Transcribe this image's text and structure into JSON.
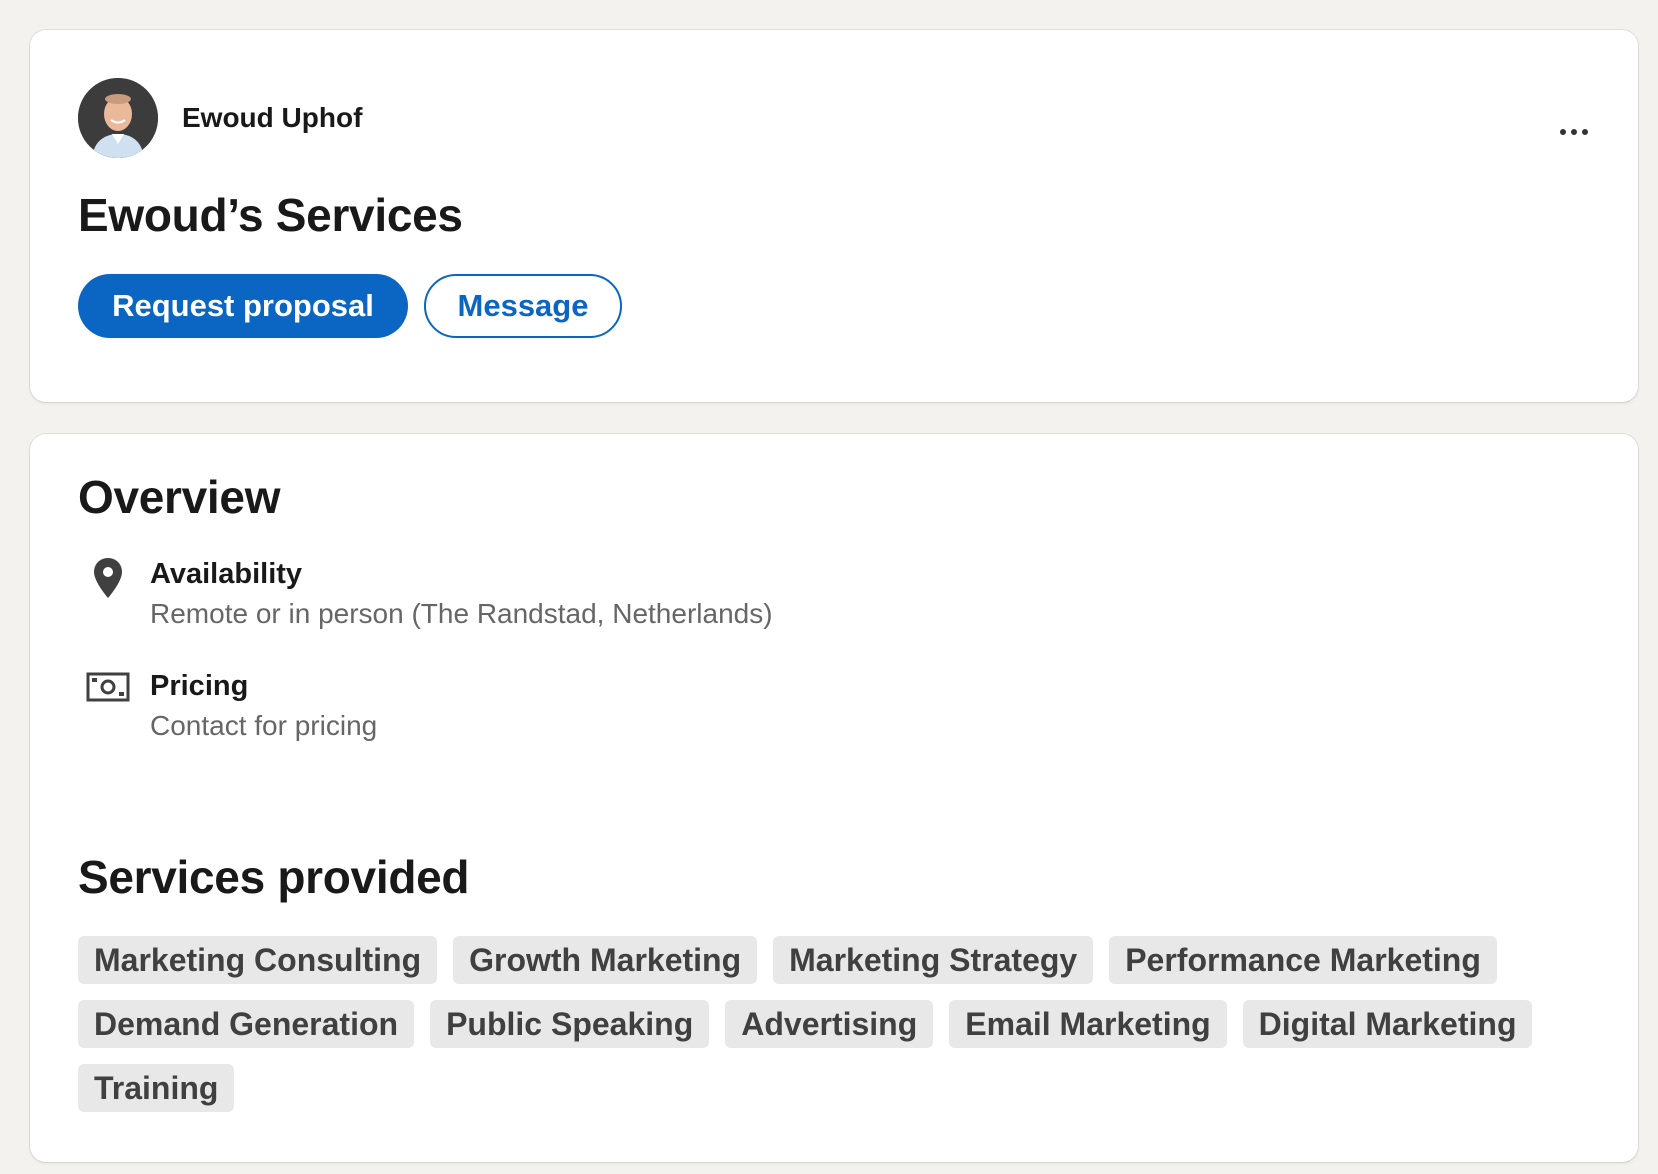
{
  "profile": {
    "name": "Ewoud Uphof",
    "services_title": "Ewoud’s Services"
  },
  "actions": {
    "request_proposal": "Request proposal",
    "message": "Message",
    "more_icon": "ellipsis-icon"
  },
  "overview": {
    "title": "Overview",
    "availability": {
      "icon": "location-pin-icon",
      "label": "Availability",
      "value": "Remote or in person (The Randstad, Netherlands)"
    },
    "pricing": {
      "icon": "money-bill-icon",
      "label": "Pricing",
      "value": "Contact for pricing"
    }
  },
  "services": {
    "title": "Services provided",
    "items": [
      "Marketing Consulting",
      "Growth Marketing",
      "Marketing Strategy",
      "Performance Marketing",
      "Demand Generation",
      "Public Speaking",
      "Advertising",
      "Email Marketing",
      "Digital Marketing",
      "Training"
    ]
  },
  "colors": {
    "accent": "#0a66c2",
    "background": "#f3f2ef",
    "chip": "#e8e8e8"
  }
}
